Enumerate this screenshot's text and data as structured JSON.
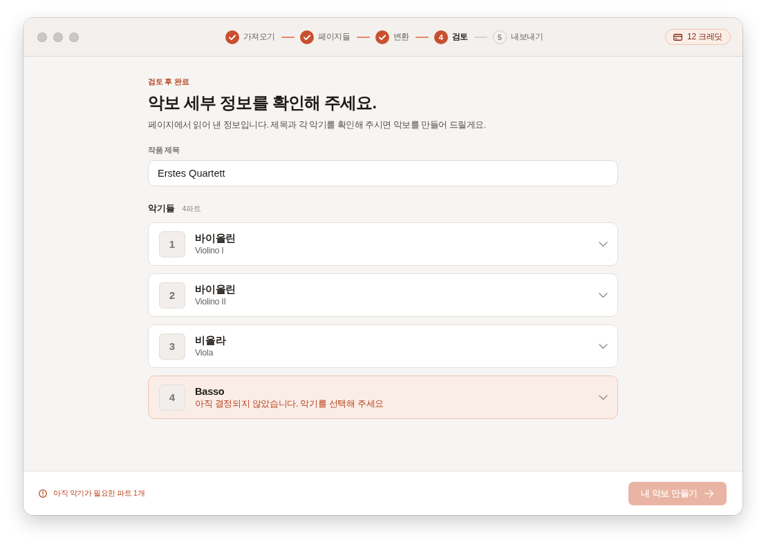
{
  "stepper": {
    "steps": [
      {
        "label": "가져오기",
        "kind": "done"
      },
      {
        "label": "페이지들",
        "kind": "done"
      },
      {
        "label": "변환",
        "kind": "done"
      },
      {
        "number": "4",
        "label": "검토",
        "kind": "current"
      },
      {
        "number": "5",
        "label": "내보내기",
        "kind": "pending"
      }
    ]
  },
  "credits": {
    "label": "12 크레딧"
  },
  "header": {
    "eyebrow": "검토 후 완료",
    "title": "악보 세부 정보를 확인해 주세요.",
    "subtitle": "페이지에서 읽어 낸 정보입니다. 제목과 각 악기를 확인해 주시면 악보를 만들어 드릴게요."
  },
  "title_field": {
    "label": "작품 제목",
    "value": "Erstes Quartett"
  },
  "instruments": {
    "heading": "악기들",
    "count": "4파트",
    "parts": [
      {
        "number": "1",
        "name": "바이올린",
        "detail": "Violino I",
        "kind": "assigned"
      },
      {
        "number": "2",
        "name": "바이올린",
        "detail": "Violino II",
        "kind": "assigned"
      },
      {
        "number": "3",
        "name": "비올라",
        "detail": "Viola",
        "kind": "assigned"
      },
      {
        "number": "4",
        "name": "Basso",
        "detail": "아직 결정되지 않았습니다. 악기를 선택해 주세요",
        "kind": "unassigned"
      }
    ]
  },
  "footer": {
    "warning": "아직 악기가 필요한 파트 1개",
    "button": {
      "label": "내 악보 만들기",
      "disabled": true
    }
  }
}
